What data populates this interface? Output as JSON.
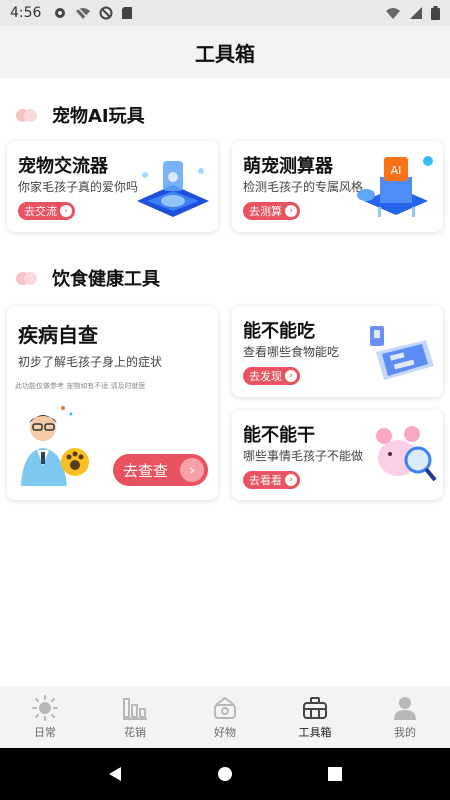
{
  "status_bar": {
    "time": "4:56"
  },
  "header": {
    "title": "工具箱"
  },
  "sections": [
    {
      "title": "宠物AI玩具"
    },
    {
      "title": "饮食健康工具"
    }
  ],
  "cards": {
    "exchange": {
      "title": "宠物交流器",
      "desc": "你家毛孩子真的爱你吗",
      "button": "去交流"
    },
    "calculator": {
      "title": "萌宠测算器",
      "desc": "检测毛孩子的专属风格",
      "button": "去测算"
    },
    "disease": {
      "title": "疾病自查",
      "desc": "初步了解毛孩子身上的症状",
      "disclaimer": "此功能仅做参考 宠物如有不适 请及时就医",
      "button": "去查查"
    },
    "can_eat": {
      "title": "能不能吃",
      "desc": "查看哪些食物能吃",
      "button": "去发现"
    },
    "can_do": {
      "title": "能不能干",
      "desc": "哪些事情毛孩子不能做",
      "button": "去看看"
    }
  },
  "tabbar": {
    "items": [
      {
        "label": "日常",
        "icon": "sun-icon"
      },
      {
        "label": "花销",
        "icon": "bar-chart-icon"
      },
      {
        "label": "好物",
        "icon": "basket-icon"
      },
      {
        "label": "工具箱",
        "icon": "toolbox-icon"
      },
      {
        "label": "我的",
        "icon": "person-icon"
      }
    ],
    "active_index": 3
  },
  "colors": {
    "accent": "#e9535f",
    "accent_light": "#f5a1a7",
    "title_bar_bg": "#f3f3f3"
  }
}
